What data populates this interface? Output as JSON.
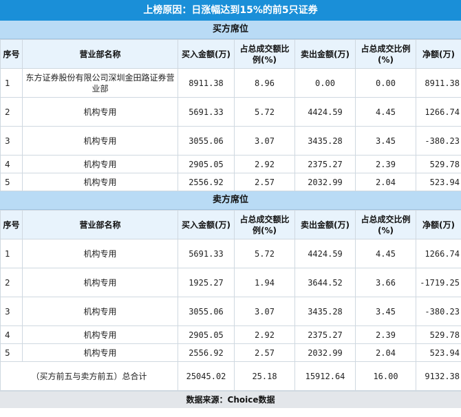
{
  "title": "上榜原因：日涨幅达到15%的前5只证券",
  "buy_section": {
    "label": "买方席位",
    "headers": [
      "序号",
      "营业部名称",
      "买入金额(万)",
      "占总成交额比例(%)",
      "卖出金额(万)",
      "占总成交比例(%)",
      "净额(万)"
    ],
    "rows": [
      {
        "idx": "1",
        "name": "东方证券股份有限公司深圳金田路证券营业部",
        "buy": "8911.38",
        "buy_pct": "8.96",
        "sell": "0.00",
        "sell_pct": "0.00",
        "net": "8911.38"
      },
      {
        "idx": "2",
        "name": "机构专用",
        "buy": "5691.33",
        "buy_pct": "5.72",
        "sell": "4424.59",
        "sell_pct": "4.45",
        "net": "1266.74"
      },
      {
        "idx": "3",
        "name": "机构专用",
        "buy": "3055.06",
        "buy_pct": "3.07",
        "sell": "3435.28",
        "sell_pct": "3.45",
        "net": "-380.23"
      },
      {
        "idx": "4",
        "name": "机构专用",
        "buy": "2905.05",
        "buy_pct": "2.92",
        "sell": "2375.27",
        "sell_pct": "2.39",
        "net": "529.78"
      },
      {
        "idx": "5",
        "name": "机构专用",
        "buy": "2556.92",
        "buy_pct": "2.57",
        "sell": "2032.99",
        "sell_pct": "2.04",
        "net": "523.94"
      }
    ]
  },
  "sell_section": {
    "label": "卖方席位",
    "headers": [
      "序号",
      "营业部名称",
      "买入金额(万)",
      "占总成交额比例(%)",
      "卖出金额(万)",
      "占总成交比例(%)",
      "净额(万)"
    ],
    "rows": [
      {
        "idx": "1",
        "name": "机构专用",
        "buy": "5691.33",
        "buy_pct": "5.72",
        "sell": "4424.59",
        "sell_pct": "4.45",
        "net": "1266.74"
      },
      {
        "idx": "2",
        "name": "机构专用",
        "buy": "1925.27",
        "buy_pct": "1.94",
        "sell": "3644.52",
        "sell_pct": "3.66",
        "net": "-1719.25"
      },
      {
        "idx": "3",
        "name": "机构专用",
        "buy": "3055.06",
        "buy_pct": "3.07",
        "sell": "3435.28",
        "sell_pct": "3.45",
        "net": "-380.23"
      },
      {
        "idx": "4",
        "name": "机构专用",
        "buy": "2905.05",
        "buy_pct": "2.92",
        "sell": "2375.27",
        "sell_pct": "2.39",
        "net": "529.78"
      },
      {
        "idx": "5",
        "name": "机构专用",
        "buy": "2556.92",
        "buy_pct": "2.57",
        "sell": "2032.99",
        "sell_pct": "2.04",
        "net": "523.94"
      }
    ],
    "total": {
      "name": "（买方前五与卖方前五）总合计",
      "buy": "25045.02",
      "buy_pct": "25.18",
      "sell": "15912.64",
      "sell_pct": "16.00",
      "net": "9132.38"
    }
  },
  "footer": "数据来源：Choice数据"
}
